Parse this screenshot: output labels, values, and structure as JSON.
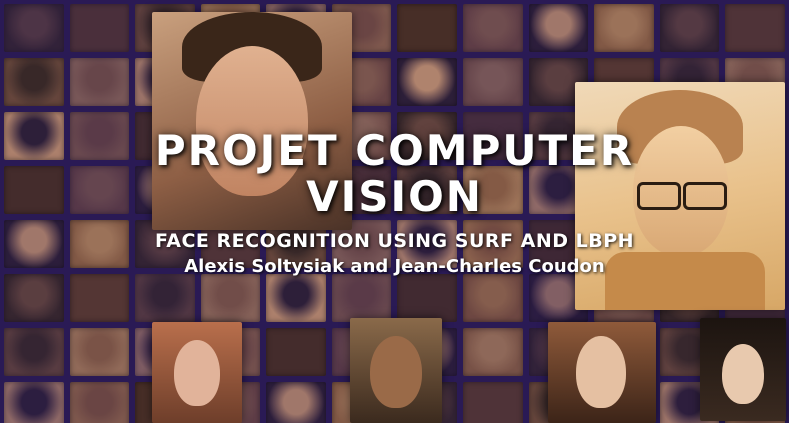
{
  "title": {
    "line1": "PROJET COMPUTER",
    "line2": "VISION"
  },
  "subtitle": "FACE RECOGNITION USING SURF AND LBPH",
  "authors": "Alexis Soltysiak and Jean-Charles Coudon",
  "colors": {
    "background": "#2a1a55",
    "text": "#ffffff"
  }
}
